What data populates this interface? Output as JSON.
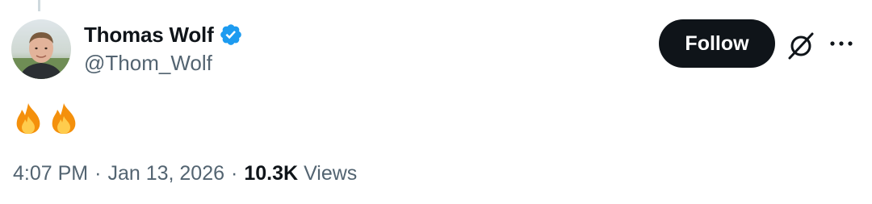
{
  "author": {
    "display_name": "Thomas Wolf",
    "handle": "@Thom_Wolf",
    "verified": true,
    "avatar_icon": "profile-photo"
  },
  "actions": {
    "follow_label": "Follow",
    "grok_icon": "slashed-circle-icon",
    "more_icon": "more-dots-icon"
  },
  "tweet": {
    "text": "🔥🔥",
    "emoji": [
      "fire",
      "fire"
    ]
  },
  "meta": {
    "time": "4:07 PM",
    "separator": "·",
    "date": "Jan 13, 2026",
    "views_count": "10.3K",
    "views_label": "Views"
  },
  "colors": {
    "text_primary": "#0f1419",
    "text_secondary": "#536471",
    "verified_blue": "#1d9bf0",
    "button_bg": "#0f1419"
  }
}
